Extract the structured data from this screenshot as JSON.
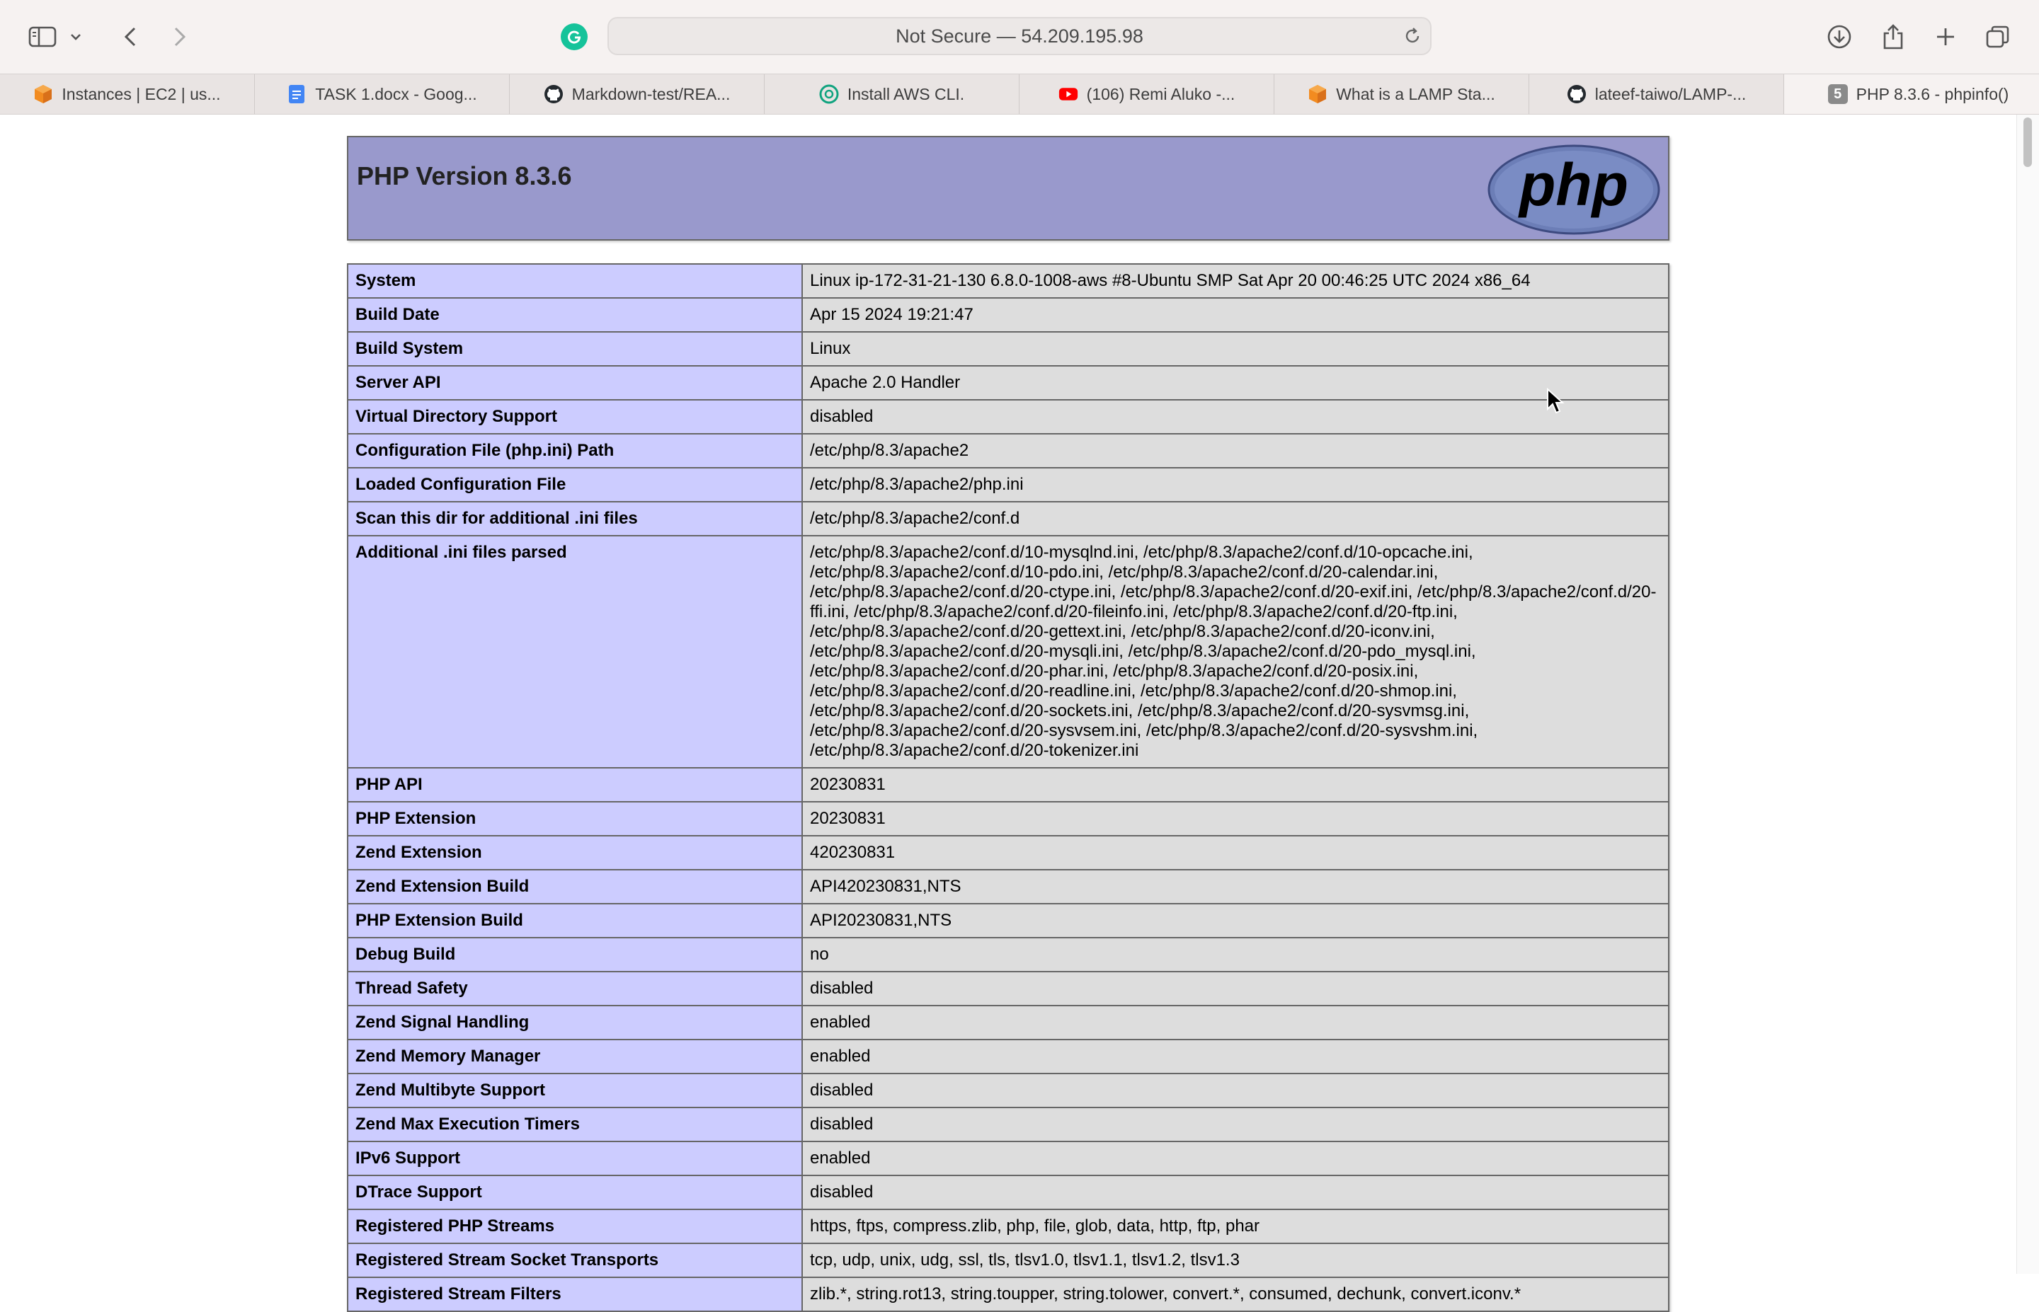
{
  "browser": {
    "address_text": "Not Secure — 54.209.195.98",
    "tabs": [
      {
        "label": "Instances | EC2 | us...",
        "icon": "aws-cube-icon"
      },
      {
        "label": "TASK 1.docx - Goog...",
        "icon": "google-docs-icon"
      },
      {
        "label": "Markdown-test/REA...",
        "icon": "github-icon"
      },
      {
        "label": "Install AWS CLI.",
        "icon": "chatgpt-icon"
      },
      {
        "label": "(106) Remi Aluko -...",
        "icon": "youtube-icon"
      },
      {
        "label": "What is a LAMP Sta...",
        "icon": "aws-cube-icon"
      },
      {
        "label": "lateef-taiwo/LAMP-...",
        "icon": "github-icon"
      },
      {
        "label": "PHP 8.3.6 - phpinfo()",
        "icon": "tab-badge-icon",
        "badge": "5",
        "active": true
      }
    ]
  },
  "page": {
    "title": "PHP Version 8.3.6",
    "logo_text": "php",
    "rows": [
      {
        "key": "System",
        "value": "Linux ip-172-31-21-130 6.8.0-1008-aws #8-Ubuntu SMP Sat Apr 20 00:46:25 UTC 2024 x86_64"
      },
      {
        "key": "Build Date",
        "value": "Apr 15 2024 19:21:47"
      },
      {
        "key": "Build System",
        "value": "Linux"
      },
      {
        "key": "Server API",
        "value": "Apache 2.0 Handler"
      },
      {
        "key": "Virtual Directory Support",
        "value": "disabled"
      },
      {
        "key": "Configuration File (php.ini) Path",
        "value": "/etc/php/8.3/apache2"
      },
      {
        "key": "Loaded Configuration File",
        "value": "/etc/php/8.3/apache2/php.ini"
      },
      {
        "key": "Scan this dir for additional .ini files",
        "value": "/etc/php/8.3/apache2/conf.d"
      },
      {
        "key": "Additional .ini files parsed",
        "value": "/etc/php/8.3/apache2/conf.d/10-mysqlnd.ini, /etc/php/8.3/apache2/conf.d/10-opcache.ini, /etc/php/8.3/apache2/conf.d/10-pdo.ini, /etc/php/8.3/apache2/conf.d/20-calendar.ini, /etc/php/8.3/apache2/conf.d/20-ctype.ini, /etc/php/8.3/apache2/conf.d/20-exif.ini, /etc/php/8.3/apache2/conf.d/20-ffi.ini, /etc/php/8.3/apache2/conf.d/20-fileinfo.ini, /etc/php/8.3/apache2/conf.d/20-ftp.ini, /etc/php/8.3/apache2/conf.d/20-gettext.ini, /etc/php/8.3/apache2/conf.d/20-iconv.ini, /etc/php/8.3/apache2/conf.d/20-mysqli.ini, /etc/php/8.3/apache2/conf.d/20-pdo_mysql.ini, /etc/php/8.3/apache2/conf.d/20-phar.ini, /etc/php/8.3/apache2/conf.d/20-posix.ini, /etc/php/8.3/apache2/conf.d/20-readline.ini, /etc/php/8.3/apache2/conf.d/20-shmop.ini, /etc/php/8.3/apache2/conf.d/20-sockets.ini, /etc/php/8.3/apache2/conf.d/20-sysvmsg.ini, /etc/php/8.3/apache2/conf.d/20-sysvsem.ini, /etc/php/8.3/apache2/conf.d/20-sysvshm.ini, /etc/php/8.3/apache2/conf.d/20-tokenizer.ini"
      },
      {
        "key": "PHP API",
        "value": "20230831"
      },
      {
        "key": "PHP Extension",
        "value": "20230831"
      },
      {
        "key": "Zend Extension",
        "value": "420230831"
      },
      {
        "key": "Zend Extension Build",
        "value": "API420230831,NTS"
      },
      {
        "key": "PHP Extension Build",
        "value": "API20230831,NTS"
      },
      {
        "key": "Debug Build",
        "value": "no"
      },
      {
        "key": "Thread Safety",
        "value": "disabled"
      },
      {
        "key": "Zend Signal Handling",
        "value": "enabled"
      },
      {
        "key": "Zend Memory Manager",
        "value": "enabled"
      },
      {
        "key": "Zend Multibyte Support",
        "value": "disabled"
      },
      {
        "key": "Zend Max Execution Timers",
        "value": "disabled"
      },
      {
        "key": "IPv6 Support",
        "value": "enabled"
      },
      {
        "key": "DTrace Support",
        "value": "disabled"
      },
      {
        "key": "Registered PHP Streams",
        "value": "https, ftps, compress.zlib, php, file, glob, data, http, ftp, phar"
      },
      {
        "key": "Registered Stream Socket Transports",
        "value": "tcp, udp, unix, udg, ssl, tls, tlsv1.0, tlsv1.1, tlsv1.2, tlsv1.3"
      },
      {
        "key": "Registered Stream Filters",
        "value": "zlib.*, string.rot13, string.toupper, string.tolower, convert.*, consumed, dechunk, convert.iconv.*"
      }
    ]
  },
  "colors": {
    "header_bg": "#9999cc",
    "key_cell_bg": "#ccccff",
    "value_cell_bg": "#dddddd",
    "border": "#666666",
    "grammarly_green": "#15c39a"
  }
}
